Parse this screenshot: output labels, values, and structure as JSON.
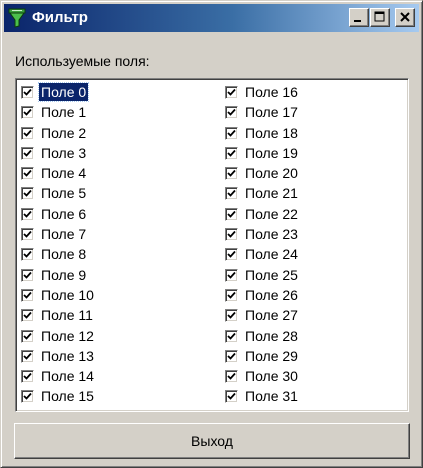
{
  "window": {
    "title": "Фильтр",
    "app_icon": "filter-funnel-icon",
    "buttons": [
      "minimize-icon",
      "maximize-icon",
      "close-icon"
    ]
  },
  "fields_label": "Используемые поля:",
  "fields": {
    "selected_index": 0,
    "column1": [
      {
        "label": "Поле 0",
        "checked": true
      },
      {
        "label": "Поле 1",
        "checked": true
      },
      {
        "label": "Поле 2",
        "checked": true
      },
      {
        "label": "Поле 3",
        "checked": true
      },
      {
        "label": "Поле 4",
        "checked": true
      },
      {
        "label": "Поле 5",
        "checked": true
      },
      {
        "label": "Поле 6",
        "checked": true
      },
      {
        "label": "Поле 7",
        "checked": true
      },
      {
        "label": "Поле 8",
        "checked": true
      },
      {
        "label": "Поле 9",
        "checked": true
      },
      {
        "label": "Поле 10",
        "checked": true
      },
      {
        "label": "Поле 11",
        "checked": true
      },
      {
        "label": "Поле 12",
        "checked": true
      },
      {
        "label": "Поле 13",
        "checked": true
      },
      {
        "label": "Поле 14",
        "checked": true
      },
      {
        "label": "Поле 15",
        "checked": true
      }
    ],
    "column2": [
      {
        "label": "Поле 16",
        "checked": true
      },
      {
        "label": "Поле 17",
        "checked": true
      },
      {
        "label": "Поле 18",
        "checked": true
      },
      {
        "label": "Поле 19",
        "checked": true
      },
      {
        "label": "Поле 20",
        "checked": true
      },
      {
        "label": "Поле 21",
        "checked": true
      },
      {
        "label": "Поле 22",
        "checked": true
      },
      {
        "label": "Поле 23",
        "checked": true
      },
      {
        "label": "Поле 24",
        "checked": true
      },
      {
        "label": "Поле 25",
        "checked": true
      },
      {
        "label": "Поле 26",
        "checked": true
      },
      {
        "label": "Поле 27",
        "checked": true
      },
      {
        "label": "Поле 28",
        "checked": true
      },
      {
        "label": "Поле 29",
        "checked": true
      },
      {
        "label": "Поле 30",
        "checked": true
      },
      {
        "label": "Поле 31",
        "checked": true
      }
    ]
  },
  "exit_button": "Выход",
  "colors": {
    "titlebar_start": "#0a246a",
    "titlebar_end": "#a6caf0",
    "window_face": "#d4d0c8",
    "selection": "#0a246a"
  }
}
